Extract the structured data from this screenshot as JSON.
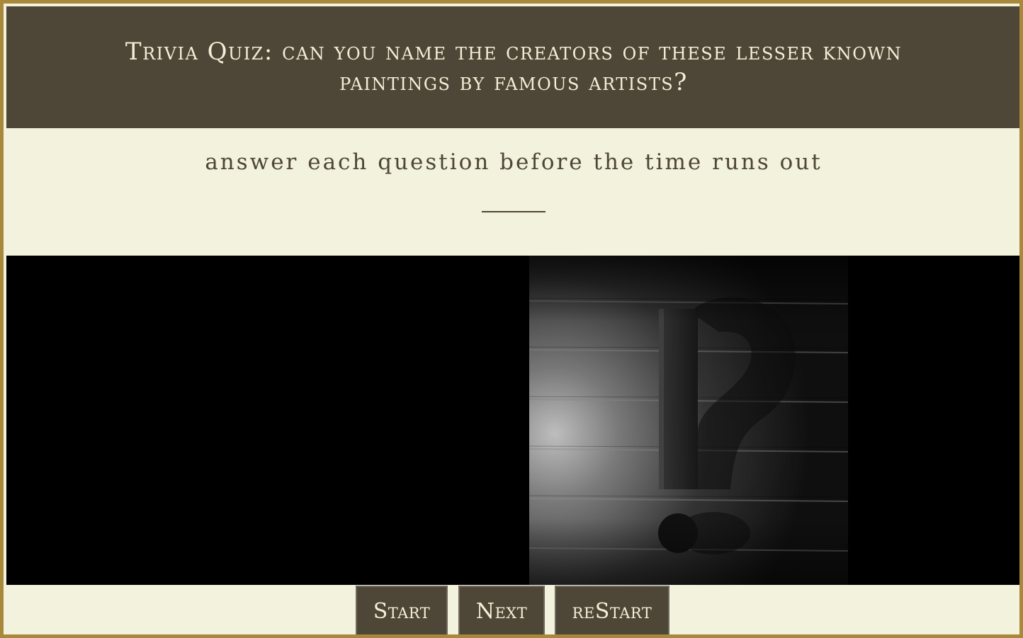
{
  "header": {
    "title": "Trivia Quiz: can you name the creators of these lesser known paintings by famous artists?"
  },
  "intro": {
    "instruction": "answer each question before the time runs out"
  },
  "media": {
    "image_subject": "question-mark-photo"
  },
  "controls": {
    "start_label": "Start",
    "next_label": "Next",
    "restart_label": "reStart"
  },
  "colors": {
    "header_bg": "#4e4636",
    "page_bg": "#f3f2dc",
    "frame_border": "#a8883a",
    "text_light": "#f2efd7",
    "media_bg": "#000000"
  }
}
